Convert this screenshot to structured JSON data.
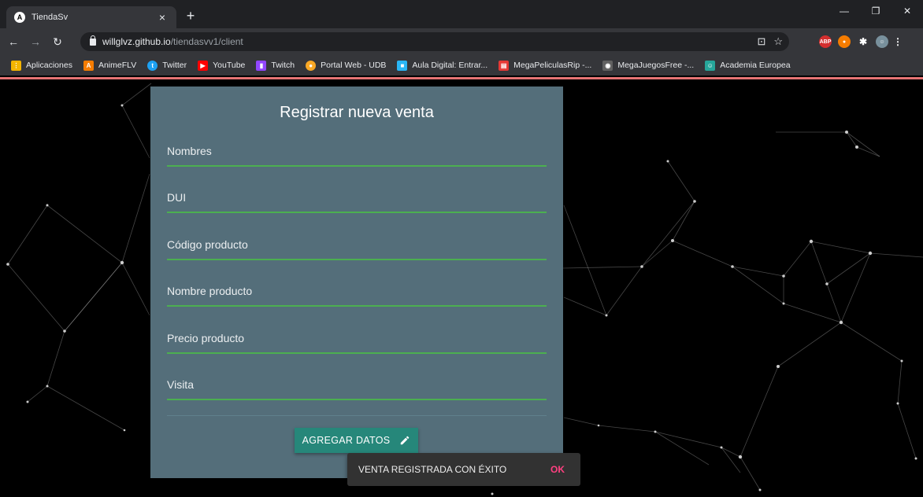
{
  "browser": {
    "tab_title": "TiendaSv",
    "tab_favicon": "A",
    "url_host": "willglvz.github.io",
    "url_path": "/tiendasvv1/client",
    "bookmarks": [
      {
        "label": "Aplicaciones",
        "icon": "apps-grid-icon",
        "color": "#f4b400"
      },
      {
        "label": "AnimeFLV",
        "icon": "animeflv-icon",
        "color": "#f57c00"
      },
      {
        "label": "Twitter",
        "icon": "twitter-icon",
        "color": "#1da1f2"
      },
      {
        "label": "YouTube",
        "icon": "youtube-icon",
        "color": "#ff0000"
      },
      {
        "label": "Twitch",
        "icon": "twitch-icon",
        "color": "#9146ff"
      },
      {
        "label": "Portal Web - UDB",
        "icon": "udb-icon",
        "color": "#f9a825"
      },
      {
        "label": "Aula Digital: Entrar...",
        "icon": "aula-icon",
        "color": "#29b6f6"
      },
      {
        "label": "MegaPeliculasRip -...",
        "icon": "clapper-icon",
        "color": "#e53935"
      },
      {
        "label": "MegaJuegosFree -...",
        "icon": "gamepad-icon",
        "color": "#9e9e9e"
      },
      {
        "label": "Academia Europea",
        "icon": "academia-icon",
        "color": "#26a69a"
      }
    ]
  },
  "form": {
    "title": "Registrar nueva venta",
    "fields": [
      {
        "label": "Nombres"
      },
      {
        "label": "DUI"
      },
      {
        "label": "Código producto"
      },
      {
        "label": "Nombre producto"
      },
      {
        "label": "Precio producto"
      },
      {
        "label": "Visita"
      }
    ],
    "submit_label": "AGREGAR DATOS"
  },
  "snackbar": {
    "message": "VENTA REGISTRADA CON ÉXITO",
    "action": "OK"
  },
  "colors": {
    "card": "#546e7a",
    "field_underline": "#4caf50",
    "button": "#26877a",
    "snack_action": "#ff4081",
    "accent_bar": "#e57373"
  }
}
